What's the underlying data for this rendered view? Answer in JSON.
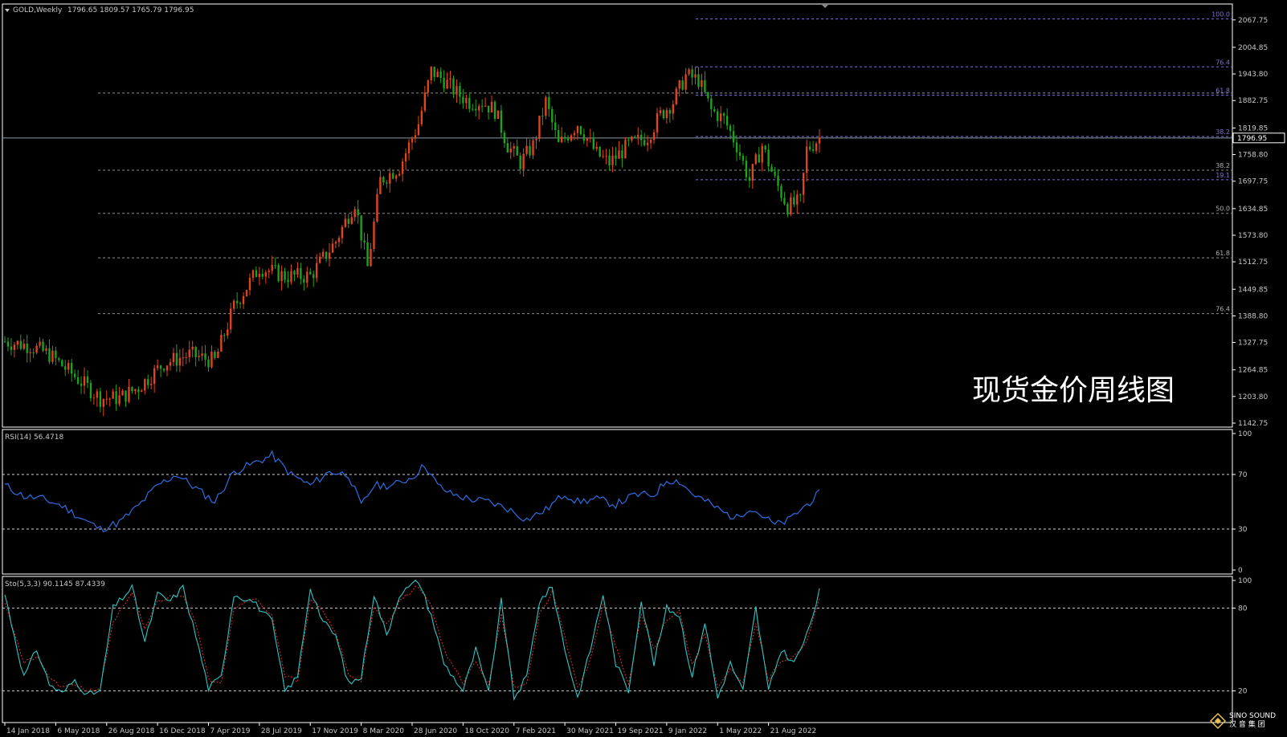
{
  "colors": {
    "bull": "#e0451d",
    "bear": "#1fa31f",
    "fib_red": "#8e8e8e",
    "fib_purple": "#8070d0",
    "rsi": "#2f6de0",
    "sto_main": "#2ec6c6",
    "sto_signal": "#e03030",
    "frame": "#ffffff",
    "level": "#d0d0d0"
  },
  "header": {
    "symbol": "GOLD,Weekly",
    "ohlc": "1796.65 1809.57 1765.79 1796.95"
  },
  "caption": "现货金价周线图",
  "rsi_label": "RSI(14) 56.4718",
  "sto_label": "Sto(5,3,3) 90.1145 87.4339",
  "logo_text": "SINO SOUND",
  "logo_sub": "汉 音 集 团",
  "chart_data": [
    {
      "type": "candlestick",
      "title": "GOLD,Weekly",
      "ylim": [
        1142.75,
        2095
      ],
      "y_ticks": [
        "2067.75",
        "2004.85",
        "1943.80",
        "1882.75",
        "1819.85",
        "1758.80",
        "1697.75",
        "1634.85",
        "1573.80",
        "1512.75",
        "1449.85",
        "1388.80",
        "1327.75",
        "1264.85",
        "1203.80",
        "1142.75"
      ],
      "current_price": "1796.95",
      "current_value": 1796.95,
      "x_labels": [
        "14 Jan 2018",
        "6 May 2018",
        "26 Aug 2018",
        "16 Dec 2018",
        "7 Apr 2019",
        "28 Jul 2019",
        "17 Nov 2019",
        "8 Mar 2020",
        "28 Jun 2020",
        "18 Oct 2020",
        "7 Feb 2021",
        "30 May 2021",
        "19 Sep 2021",
        "9 Jan 2022",
        "1 May 2022",
        "21 Aug 2022"
      ],
      "x_label_positions": [
        0,
        16,
        32,
        48,
        64,
        80,
        96,
        112,
        128,
        144,
        160,
        176,
        192,
        208,
        224,
        240
      ],
      "bars_total": 256,
      "close_path": [
        [
          0,
          1330
        ],
        [
          8,
          1320
        ],
        [
          14,
          1300
        ],
        [
          22,
          1250
        ],
        [
          30,
          1200
        ],
        [
          36,
          1200
        ],
        [
          42,
          1225
        ],
        [
          50,
          1280
        ],
        [
          58,
          1300
        ],
        [
          66,
          1285
        ],
        [
          72,
          1410
        ],
        [
          80,
          1500
        ],
        [
          88,
          1480
        ],
        [
          96,
          1480
        ],
        [
          104,
          1560
        ],
        [
          110,
          1650
        ],
        [
          114,
          1500
        ],
        [
          118,
          1700
        ],
        [
          124,
          1730
        ],
        [
          130,
          1830
        ],
        [
          134,
          1950
        ],
        [
          138,
          1930
        ],
        [
          142,
          1900
        ],
        [
          146,
          1880
        ],
        [
          150,
          1880
        ],
        [
          154,
          1860
        ],
        [
          158,
          1780
        ],
        [
          162,
          1740
        ],
        [
          166,
          1780
        ],
        [
          170,
          1880
        ],
        [
          174,
          1780
        ],
        [
          180,
          1830
        ],
        [
          186,
          1760
        ],
        [
          190,
          1740
        ],
        [
          196,
          1780
        ],
        [
          202,
          1800
        ],
        [
          206,
          1850
        ],
        [
          210,
          1880
        ],
        [
          214,
          1940
        ],
        [
          218,
          1930
        ],
        [
          222,
          1860
        ],
        [
          226,
          1840
        ],
        [
          230,
          1780
        ],
        [
          234,
          1700
        ],
        [
          238,
          1780
        ],
        [
          242,
          1700
        ],
        [
          246,
          1640
        ],
        [
          250,
          1650
        ],
        [
          252,
          1770
        ],
        [
          256,
          1797
        ]
      ],
      "fib_levels_left": [
        {
          "label": "38.2",
          "value": 1723
        },
        {
          "label": "50.0",
          "value": 1624
        },
        {
          "label": "61.8",
          "value": 1522
        },
        {
          "label": "76.4",
          "value": 1394
        },
        {
          "label": "",
          "value": 1900
        }
      ],
      "fib_levels_right": [
        {
          "label": "100.0",
          "value": 2070
        },
        {
          "label": "76.4",
          "value": 1960
        },
        {
          "label": "61.8",
          "value": 1895
        },
        {
          "label": "38.2",
          "value": 1800
        },
        {
          "label": "19.1",
          "value": 1701
        }
      ]
    },
    {
      "type": "line",
      "title": "RSI(14) 56.4718",
      "ylim": [
        0,
        100
      ],
      "y_ticks": [
        "100",
        "70",
        "30",
        "0"
      ],
      "levels": [
        70,
        30
      ],
      "bars_total": 256,
      "points": [
        [
          0,
          62
        ],
        [
          6,
          54
        ],
        [
          12,
          52
        ],
        [
          18,
          47
        ],
        [
          24,
          38
        ],
        [
          30,
          30
        ],
        [
          36,
          35
        ],
        [
          42,
          47
        ],
        [
          48,
          62
        ],
        [
          54,
          70
        ],
        [
          60,
          60
        ],
        [
          66,
          50
        ],
        [
          72,
          72
        ],
        [
          78,
          78
        ],
        [
          84,
          84
        ],
        [
          90,
          70
        ],
        [
          96,
          62
        ],
        [
          102,
          72
        ],
        [
          108,
          70
        ],
        [
          112,
          47
        ],
        [
          116,
          62
        ],
        [
          122,
          62
        ],
        [
          128,
          68
        ],
        [
          132,
          77
        ],
        [
          136,
          62
        ],
        [
          140,
          56
        ],
        [
          146,
          52
        ],
        [
          152,
          50
        ],
        [
          158,
          45
        ],
        [
          164,
          37
        ],
        [
          170,
          44
        ],
        [
          176,
          56
        ],
        [
          180,
          50
        ],
        [
          186,
          52
        ],
        [
          192,
          48
        ],
        [
          198,
          55
        ],
        [
          204,
          55
        ],
        [
          208,
          66
        ],
        [
          212,
          65
        ],
        [
          216,
          56
        ],
        [
          222,
          48
        ],
        [
          226,
          42
        ],
        [
          230,
          38
        ],
        [
          234,
          46
        ],
        [
          238,
          40
        ],
        [
          242,
          33
        ],
        [
          246,
          36
        ],
        [
          252,
          48
        ],
        [
          256,
          56
        ]
      ]
    },
    {
      "type": "line",
      "title": "Sto(5,3,3) 90.1145 87.4339",
      "ylim": [
        0,
        100
      ],
      "y_ticks": [
        "100",
        "80",
        "20"
      ],
      "levels": [
        80,
        20
      ],
      "bars_total": 256,
      "main": [
        [
          0,
          90
        ],
        [
          6,
          30
        ],
        [
          10,
          50
        ],
        [
          14,
          25
        ],
        [
          18,
          18
        ],
        [
          22,
          28
        ],
        [
          26,
          17
        ],
        [
          30,
          20
        ],
        [
          34,
          80
        ],
        [
          40,
          95
        ],
        [
          44,
          55
        ],
        [
          48,
          90
        ],
        [
          52,
          85
        ],
        [
          56,
          95
        ],
        [
          60,
          60
        ],
        [
          64,
          22
        ],
        [
          68,
          30
        ],
        [
          72,
          90
        ],
        [
          78,
          85
        ],
        [
          84,
          70
        ],
        [
          88,
          20
        ],
        [
          92,
          30
        ],
        [
          96,
          95
        ],
        [
          100,
          70
        ],
        [
          104,
          60
        ],
        [
          108,
          25
        ],
        [
          112,
          30
        ],
        [
          116,
          90
        ],
        [
          120,
          60
        ],
        [
          124,
          90
        ],
        [
          130,
          100
        ],
        [
          134,
          75
        ],
        [
          138,
          40
        ],
        [
          144,
          20
        ],
        [
          148,
          50
        ],
        [
          152,
          18
        ],
        [
          156,
          85
        ],
        [
          160,
          15
        ],
        [
          164,
          30
        ],
        [
          168,
          85
        ],
        [
          172,
          95
        ],
        [
          176,
          50
        ],
        [
          180,
          15
        ],
        [
          184,
          50
        ],
        [
          188,
          90
        ],
        [
          192,
          40
        ],
        [
          196,
          20
        ],
        [
          200,
          85
        ],
        [
          204,
          40
        ],
        [
          208,
          80
        ],
        [
          212,
          75
        ],
        [
          216,
          30
        ],
        [
          220,
          70
        ],
        [
          224,
          15
        ],
        [
          228,
          40
        ],
        [
          232,
          20
        ],
        [
          236,
          80
        ],
        [
          240,
          20
        ],
        [
          244,
          50
        ],
        [
          248,
          40
        ],
        [
          252,
          60
        ],
        [
          256,
          92
        ]
      ],
      "signal": [
        [
          0,
          85
        ],
        [
          6,
          40
        ],
        [
          10,
          45
        ],
        [
          14,
          30
        ],
        [
          18,
          22
        ],
        [
          22,
          25
        ],
        [
          26,
          20
        ],
        [
          30,
          22
        ],
        [
          34,
          70
        ],
        [
          40,
          90
        ],
        [
          44,
          65
        ],
        [
          48,
          85
        ],
        [
          52,
          88
        ],
        [
          56,
          90
        ],
        [
          60,
          70
        ],
        [
          64,
          28
        ],
        [
          68,
          27
        ],
        [
          72,
          80
        ],
        [
          78,
          88
        ],
        [
          84,
          75
        ],
        [
          88,
          30
        ],
        [
          92,
          28
        ],
        [
          96,
          85
        ],
        [
          100,
          78
        ],
        [
          104,
          62
        ],
        [
          108,
          32
        ],
        [
          112,
          28
        ],
        [
          116,
          80
        ],
        [
          120,
          68
        ],
        [
          124,
          85
        ],
        [
          130,
          96
        ],
        [
          134,
          82
        ],
        [
          138,
          50
        ],
        [
          144,
          25
        ],
        [
          148,
          42
        ],
        [
          152,
          25
        ],
        [
          156,
          75
        ],
        [
          160,
          22
        ],
        [
          164,
          25
        ],
        [
          168,
          75
        ],
        [
          172,
          92
        ],
        [
          176,
          60
        ],
        [
          180,
          22
        ],
        [
          184,
          42
        ],
        [
          188,
          82
        ],
        [
          192,
          52
        ],
        [
          196,
          25
        ],
        [
          200,
          75
        ],
        [
          204,
          50
        ],
        [
          208,
          72
        ],
        [
          212,
          78
        ],
        [
          216,
          38
        ],
        [
          220,
          62
        ],
        [
          224,
          22
        ],
        [
          228,
          35
        ],
        [
          232,
          25
        ],
        [
          236,
          70
        ],
        [
          240,
          28
        ],
        [
          244,
          42
        ],
        [
          248,
          45
        ],
        [
          252,
          55
        ],
        [
          256,
          87
        ]
      ]
    }
  ]
}
